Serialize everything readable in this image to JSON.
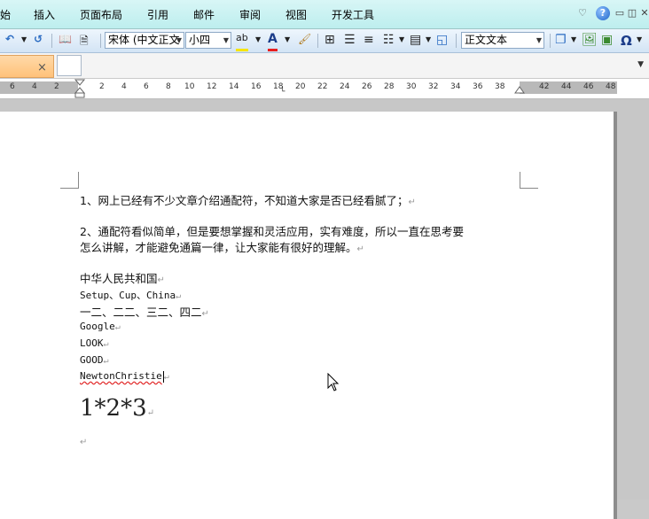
{
  "menu": {
    "items": [
      "始",
      "插入",
      "页面布局",
      "引用",
      "邮件",
      "审阅",
      "视图",
      "开发工具"
    ],
    "help": "?"
  },
  "toolbar": {
    "font_name": "宋体 (中文正文",
    "font_size": "小四",
    "style": "正文文本",
    "highlight_label": "ab",
    "font_color_label": "A",
    "special_char": "Ω"
  },
  "tabs": {
    "close": "×"
  },
  "ruler": {
    "labels": [
      "6",
      "4",
      "2",
      "2",
      "4",
      "6",
      "8",
      "10",
      "12",
      "14",
      "16",
      "18",
      "20",
      "22",
      "24",
      "26",
      "28",
      "30",
      "32",
      "34",
      "36",
      "38",
      "42",
      "44",
      "46",
      "48"
    ]
  },
  "document": {
    "paragraphs": [
      "1、网上已经有不少文章介绍通配符，不知道大家是否已经看腻了；",
      "2、通配符看似简单，但是要想掌握和灵活应用，实有难度，所以一直在思考要",
      "怎么讲解，才能避免通篇一律，让大家能有很好的理解。",
      "中华人民共和国",
      "Setup、Cup、China",
      "一二、二二、三二、四二",
      "Google",
      "LOOK",
      "GOOD",
      "NewtonChristie",
      "1*2*3"
    ],
    "paragraph_mark": "↵"
  }
}
